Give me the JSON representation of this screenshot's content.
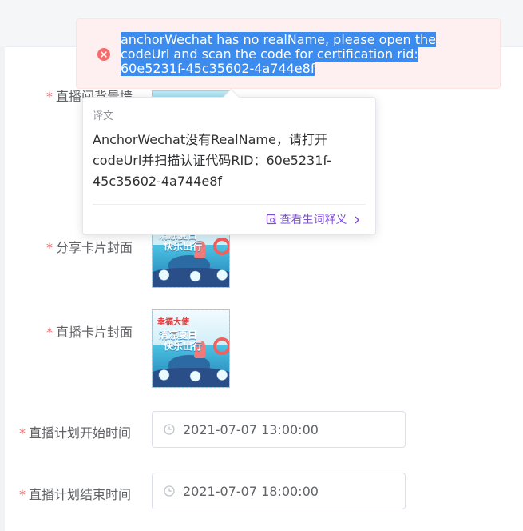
{
  "form": {
    "labels": {
      "background": "直播间背景墙",
      "share_cover": "分享卡片封面",
      "live_cover": "直播卡片封面",
      "plan_start": "直播计划开始时间",
      "plan_end": "直播计划结束时间"
    },
    "required_mark": "*",
    "plan_start_value": "2021-07-07 13:00:00",
    "plan_end_value": "2021-07-07 18:00:00",
    "thumbnail": {
      "badge": "幸福大使",
      "title_line1": "清凉夏日",
      "title_line2": "快乐出行"
    }
  },
  "error_toast": {
    "line1": "anchorWechat has no realName, please open the",
    "line2": "codeUrl and scan the code for certification rid:",
    "line3": "60e5231f-45c35602-4a744e8f",
    "status_color": "#f56c6c"
  },
  "translation_popup": {
    "header": "译文",
    "text_line1": "AnchorWechat没有RealName，请打开",
    "text_line2": "codeUrl并扫描认证代码RID：60e5231f-",
    "text_line3": "45c35602-4a744e8f",
    "link_label": "查看生词释义",
    "link_color": "#7d4cdb"
  }
}
